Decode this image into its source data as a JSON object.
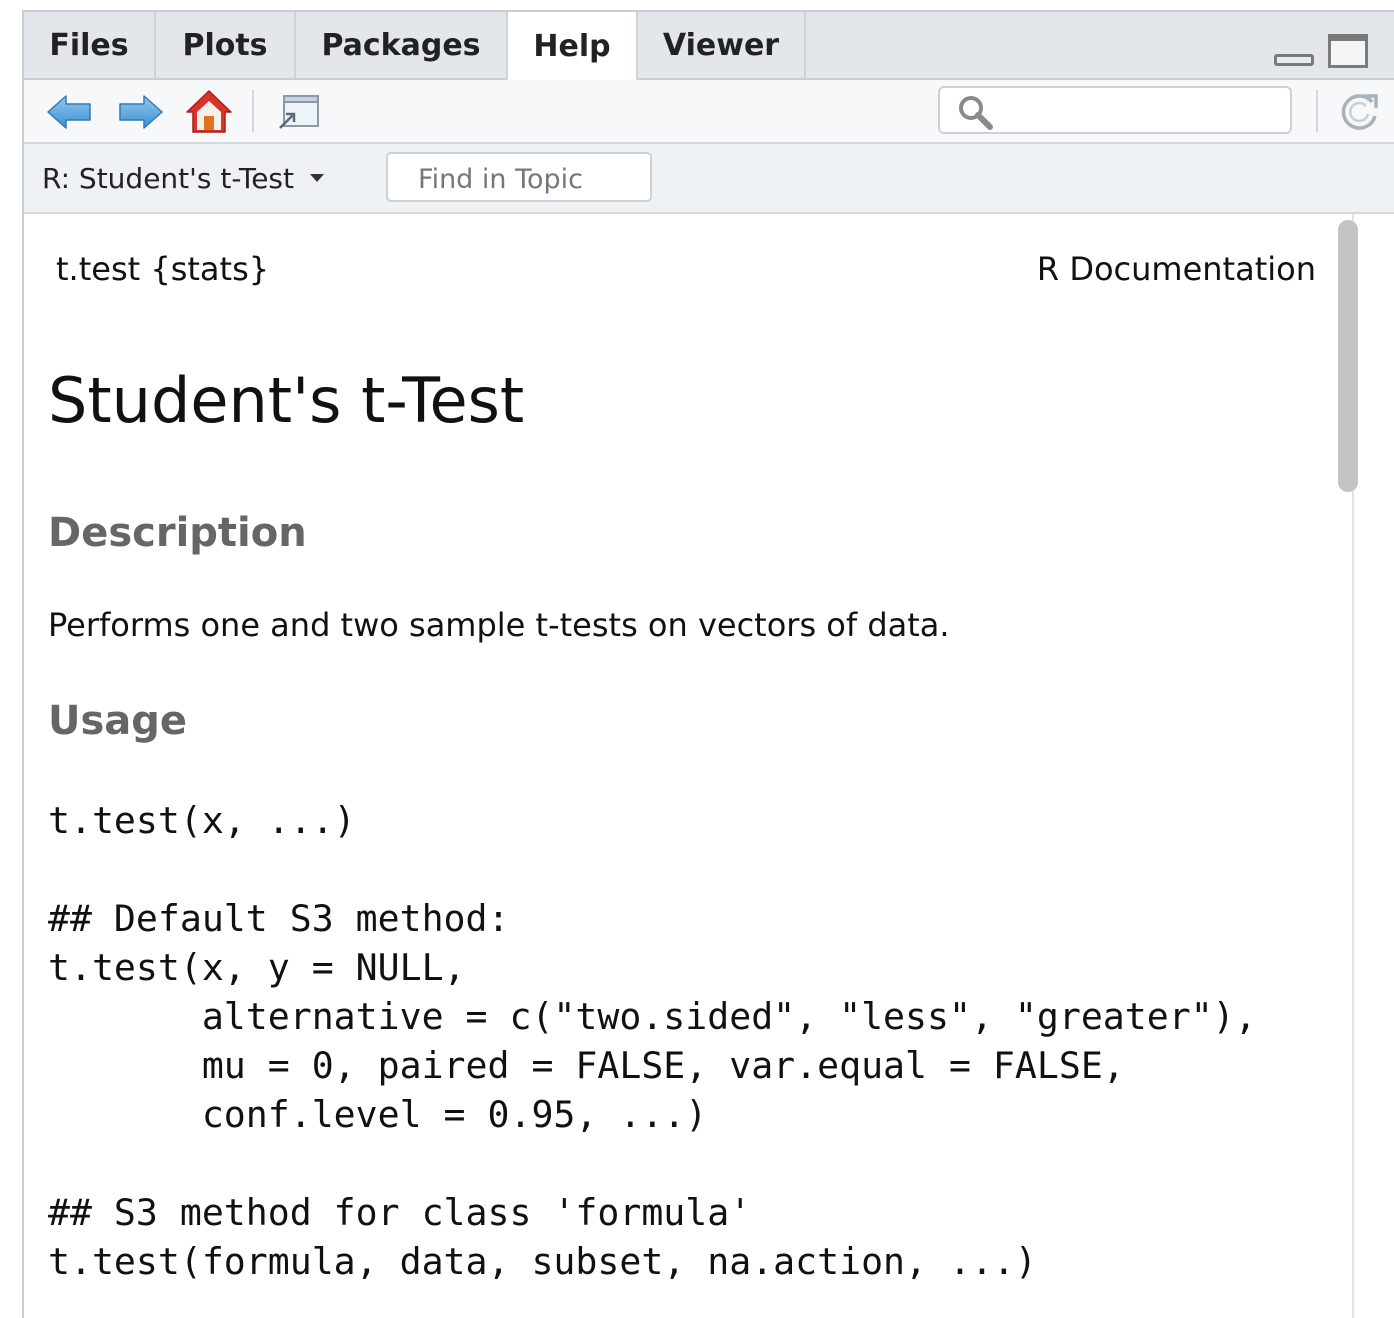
{
  "tabs": [
    {
      "label": "Files",
      "active": false
    },
    {
      "label": "Plots",
      "active": false
    },
    {
      "label": "Packages",
      "active": false
    },
    {
      "label": "Help",
      "active": true
    },
    {
      "label": "Viewer",
      "active": false
    }
  ],
  "toolbar": {
    "icons": [
      "back-arrow-icon",
      "forward-arrow-icon",
      "home-icon",
      "popout-icon",
      "search-icon",
      "refresh-icon"
    ],
    "search_value": "",
    "search_placeholder": ""
  },
  "topic_bar": {
    "topic": "R: Student's t-Test",
    "find_placeholder": "Find in Topic"
  },
  "doc": {
    "header_left": "t.test {stats}",
    "header_right": "R Documentation",
    "title": "Student's t-Test",
    "description_heading": "Description",
    "description": "Performs one and two sample t-tests on vectors of data.",
    "usage_heading": "Usage",
    "usage_code": [
      "t.test(x, ...)",
      "",
      "## Default S3 method:",
      "t.test(x, y = NULL,",
      "       alternative = c(\"two.sided\", \"less\", \"greater\"),",
      "       mu = 0, paired = FALSE, var.equal = FALSE,",
      "       conf.level = 0.95, ...)",
      "",
      "## S3 method for class 'formula'",
      "t.test(formula, data, subset, na.action, ...)"
    ]
  },
  "colors": {
    "tab_bar_bg": "#e3e6ea",
    "toolbar_bg": "#f7f8f9",
    "topic_bar_bg": "#eef2f5",
    "heading_gray": "#666666",
    "arrow_blue": "#5aa7e0",
    "home_red": "#d9342b",
    "scroll_thumb": "#c4c4c4"
  }
}
